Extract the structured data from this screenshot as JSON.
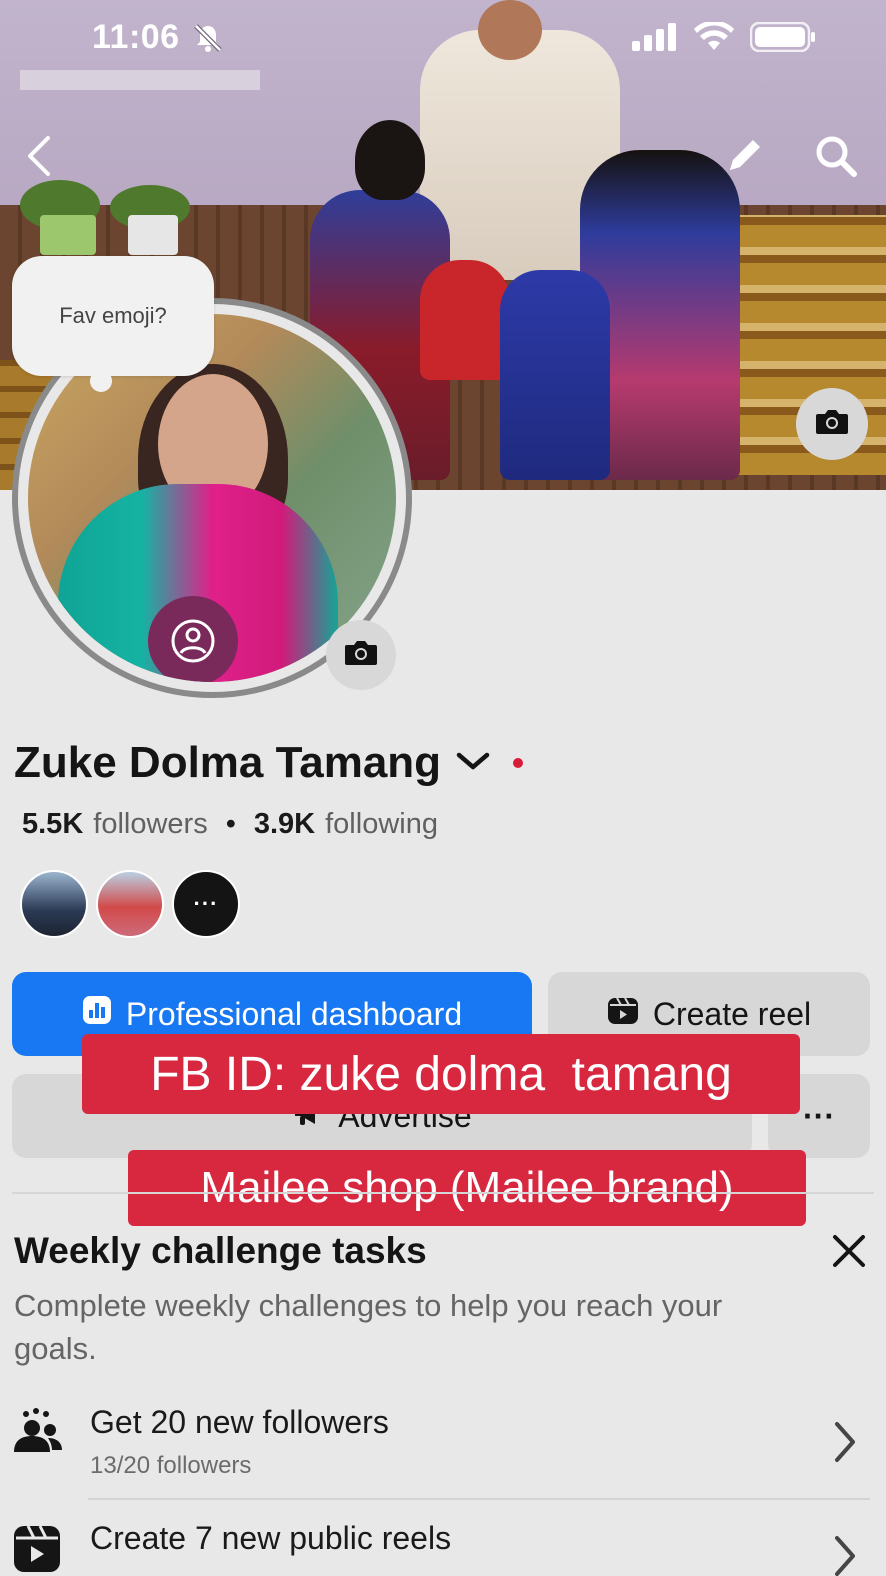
{
  "status_bar": {
    "time": "11:06"
  },
  "profile": {
    "prompt_bubble": "Fav emoji?",
    "name": "Zuke Dolma Tamang",
    "followers_count": "5.5K",
    "followers_label": "followers",
    "following_count": "3.9K",
    "following_label": "following",
    "separator": "•",
    "more_friends": "···"
  },
  "actions": {
    "professional_dashboard": "Professional dashboard",
    "create_reel": "Create reel",
    "advertise": "Advertise",
    "more": "···"
  },
  "captions": {
    "line1": "FB ID: zuke dolma  tamang",
    "line2": "Mailee shop (Mailee brand)"
  },
  "weekly_challenge": {
    "title": "Weekly challenge tasks",
    "description": "Complete weekly challenges to help you reach your goals.",
    "tasks": [
      {
        "title": "Get 20 new followers",
        "progress_text": "13/20 followers",
        "progress": 0.65
      },
      {
        "title": "Create 7 new public reels"
      }
    ]
  },
  "colors": {
    "primary_blue": "#1877f2",
    "caption_red": "#d8283f",
    "background": "#e9e8e8"
  }
}
